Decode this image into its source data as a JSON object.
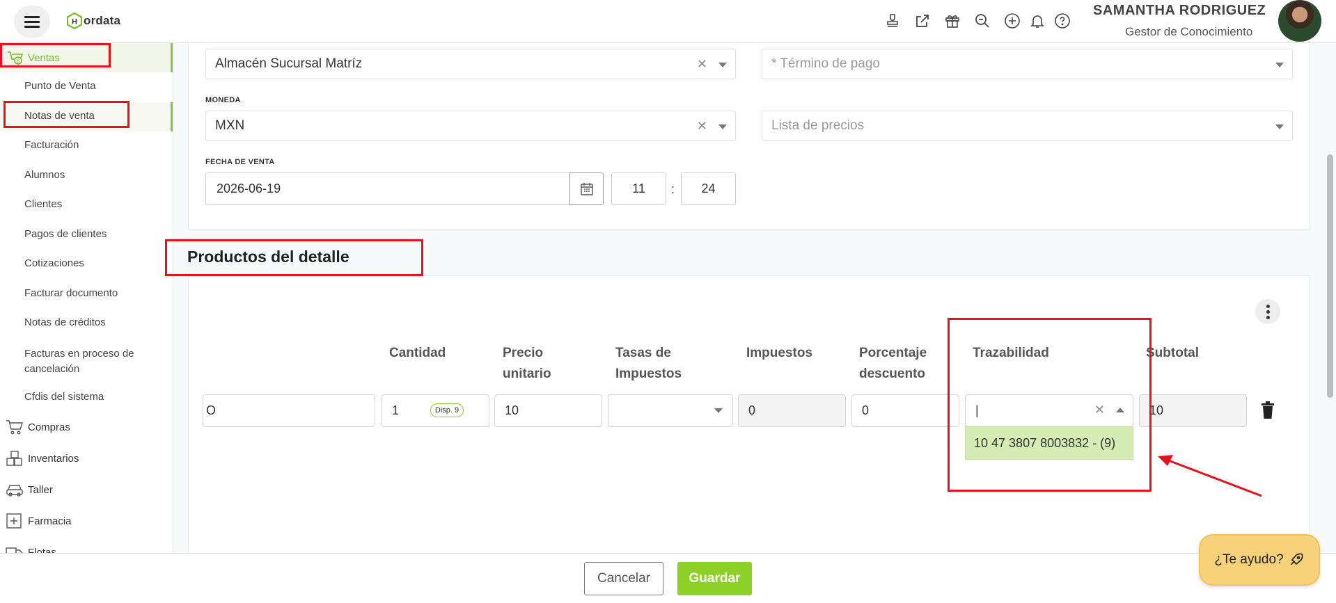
{
  "header": {
    "logo_text": "ordata",
    "user_name": "SAMANTHA RODRIGUEZ",
    "user_role": "Gestor de Conocimiento",
    "icons": [
      "stamp-icon",
      "external-link-icon",
      "gift-icon",
      "search-zoom-icon",
      "plus-circle-icon",
      "bell-icon",
      "help-circle-icon"
    ]
  },
  "sidebar": {
    "top": "Ventas",
    "items": [
      "Punto de Venta",
      "Notas de venta",
      "Facturación",
      "Alumnos",
      "Clientes",
      "Pagos de clientes",
      "Cotizaciones",
      "Facturar documento",
      "Notas de créditos",
      "Facturas en proceso de cancelación",
      "Cfdis del sistema"
    ],
    "groups": [
      "Compras",
      "Inventarios",
      "Taller",
      "Farmacia",
      "Flotas"
    ]
  },
  "form": {
    "almacen": "Almacén Sucursal Matríz",
    "termino_placeholder": "* Término de pago",
    "moneda_label": "MONEDA",
    "moneda": "MXN",
    "lista_placeholder": "Lista de precios",
    "fecha_label": "FECHA DE VENTA",
    "fecha": "2026-06-19",
    "hora": "11",
    "minuto": "24"
  },
  "products": {
    "title": "Productos del detalle",
    "columns": {
      "cantidad": "Cantidad",
      "precio_l1": "Precio",
      "precio_l2": "unitario",
      "tasas_l1": "Tasas de",
      "tasas_l2": "Impuestos",
      "impuestos": "Impuestos",
      "porcentaje_l1": "Porcentaje",
      "porcentaje_l2": "descuento",
      "trazabilidad": "Trazabilidad",
      "subtotal": "Subtotal"
    },
    "row": {
      "descripcion": "O",
      "cantidad": "1",
      "disponible": "Disp. 9",
      "precio": "10",
      "impuestos": "0",
      "descuento": "0",
      "trazabilidad": "|",
      "subtotal": "10"
    },
    "trazabilidad_option": "10 47 3807 8003832 - (9)"
  },
  "footer": {
    "cancel": "Cancelar",
    "save": "Guardar",
    "help": "¿Te ayudo?"
  },
  "colors": {
    "accent": "#8cc63f",
    "annotation": "#e3121c",
    "help_bg": "#f8d27a"
  }
}
